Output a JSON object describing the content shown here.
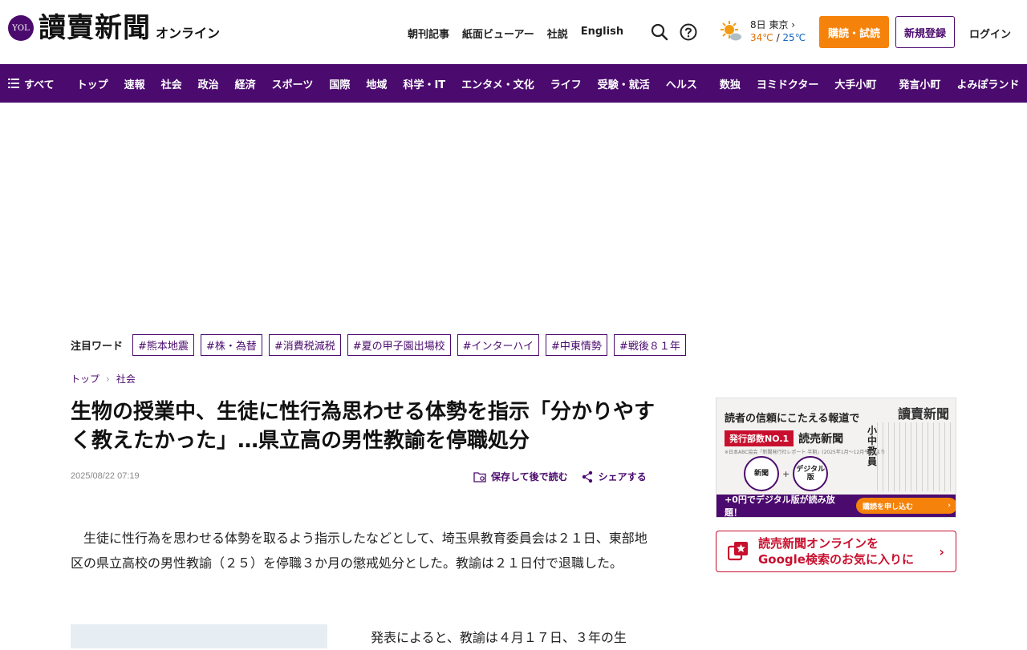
{
  "header": {
    "logo_badge": "YOL",
    "logo_text": "讀賣新聞",
    "logo_sub": "オンライン",
    "links": [
      "朝刊記事",
      "紙面ビューアー",
      "社説",
      "English"
    ],
    "weather": {
      "day_city": "8日 東京",
      "high": "34℃",
      "sep": " / ",
      "low": "25℃"
    },
    "subscribe_label": "購読・試読",
    "register_label": "新規登録",
    "login_label": "ログイン",
    "colors": {
      "brand": "#4b0b6e",
      "accent": "#f5820a"
    }
  },
  "nav": {
    "menu_label": "すべて",
    "items_a": [
      "トップ",
      "速報",
      "社会",
      "政治",
      "経済",
      "スポーツ",
      "国際",
      "地域",
      "科学・IT",
      "エンタメ・文化",
      "ライフ",
      "受験・就活",
      "ヘルス"
    ],
    "items_b": [
      "数独",
      "ヨミドクター",
      "大手小町"
    ],
    "items_c": [
      "発言小町",
      "よみぽランド"
    ]
  },
  "trending": {
    "label": "注目ワード",
    "tags": [
      "#熊本地震",
      "#株・為替",
      "#消費税減税",
      "#夏の甲子園出場校",
      "#インターハイ",
      "#中東情勢",
      "#戦後８１年"
    ]
  },
  "breadcrumb": [
    "トップ",
    "社会"
  ],
  "article": {
    "title": "生物の授業中、生徒に性行為思わせる体勢を指示「分かりやすく教えたかった」…県立高の男性教諭を停職処分",
    "date": "2025/08/22 07:19",
    "save_label": "保存して後で読む",
    "share_label": "シェアする",
    "lead": "　生徒に性行為を思わせる体勢を取るよう指示したなどとして、埼玉県教育委員会は２１日、東部地区の県立高校の男性教諭（２５）を停職３か月の懲戒処分とした。教諭は２１日付で退職した。",
    "para2": "　発表によると、教諭は４月１７日、３年の生"
  },
  "sidebar": {
    "ad": {
      "headline": "読者の信頼にこたえる報道で",
      "paper_title": "讀賣新聞",
      "no1_badge": "発行部数NO.1",
      "no1_name": "読売新聞",
      "note": "※日本ABC協会「新聞発行社レポート 半期」(2025年1月～12月平均)より",
      "circle1": "新聞",
      "circle2": "デジタル版",
      "bar_text": "+0円でデジタル版が読み放題！",
      "bar_cta": "購読を申し込む",
      "big_text": "小中教員"
    },
    "favorite": {
      "line1": "読売新聞オンラインを",
      "line2": "Google検索のお気に入りに"
    }
  }
}
